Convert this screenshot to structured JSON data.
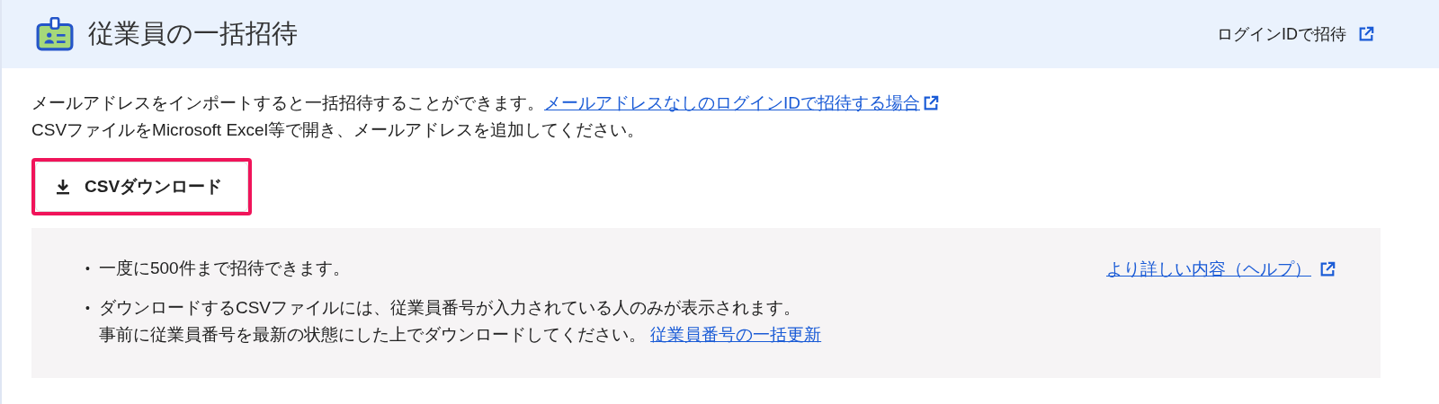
{
  "header": {
    "title": "従業員の一括招待",
    "link": "ログインIDで招待"
  },
  "intro": {
    "text": "メールアドレスをインポートすると一括招待することができます。",
    "link": "メールアドレスなしのログインIDで招待する場合",
    "line2": "CSVファイルをMicrosoft Excel等で開き、メールアドレスを追加してください。"
  },
  "download_button": {
    "label": "CSVダウンロード",
    "highlighted": true
  },
  "notes": {
    "items": [
      {
        "bullet": "•",
        "lines": [
          "一度に500件まで招待できます。"
        ]
      },
      {
        "bullet": "•",
        "lines": [
          "ダウンロードするCSVファイルには、従業員番号が入力されている人のみが表示されます。",
          "事前に従業員番号を最新の状態にした上でダウンロードしてください。"
        ],
        "link": "従業員番号の一括更新"
      }
    ],
    "help_link": "より詳しい内容（ヘルプ）"
  }
}
